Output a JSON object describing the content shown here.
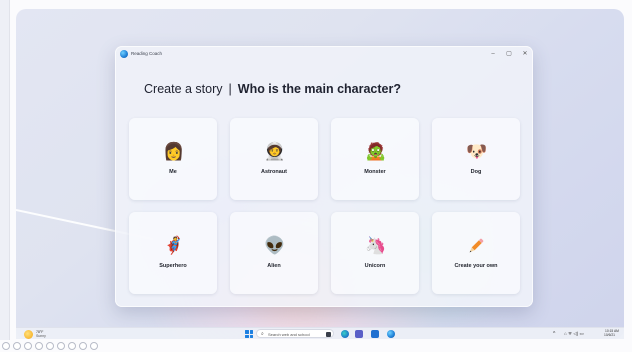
{
  "window": {
    "app_title": "Reading Coach",
    "minimize_glyph": "–",
    "maximize_glyph": "▢",
    "close_glyph": "✕"
  },
  "heading": {
    "prefix": "Create a story",
    "separator": "|",
    "question": "Who is the main character?"
  },
  "characters": [
    {
      "label": "Me",
      "icon": "me-avatar-icon",
      "glyph": "👩"
    },
    {
      "label": "Astronaut",
      "icon": "astronaut-icon",
      "glyph": "🧑‍🚀"
    },
    {
      "label": "Monster",
      "icon": "monster-icon",
      "glyph": "🧟"
    },
    {
      "label": "Dog",
      "icon": "dog-icon",
      "glyph": "🐶"
    },
    {
      "label": "Superhero",
      "icon": "superhero-icon",
      "glyph": "🦸"
    },
    {
      "label": "Alien",
      "icon": "alien-icon",
      "glyph": "👽"
    },
    {
      "label": "Unicorn",
      "icon": "unicorn-icon",
      "glyph": "🦄"
    },
    {
      "label": "Create your own",
      "icon": "pencil-icon",
      "glyph": ""
    }
  ],
  "taskbar": {
    "weather_temp": "78°F",
    "weather_condition": "Sunny",
    "search_placeholder": "Search web and school",
    "search_glyph": "⌕",
    "clock_time": "10:15 AM",
    "clock_date": "10/6/21",
    "tray_chevron": "^",
    "tray_glyphs": "⌂ ᯤ ◁) ▭"
  },
  "colors": {
    "accent": "#1c7fe0",
    "tile_bg": "#f8f9fd",
    "text": "#1f2230"
  }
}
